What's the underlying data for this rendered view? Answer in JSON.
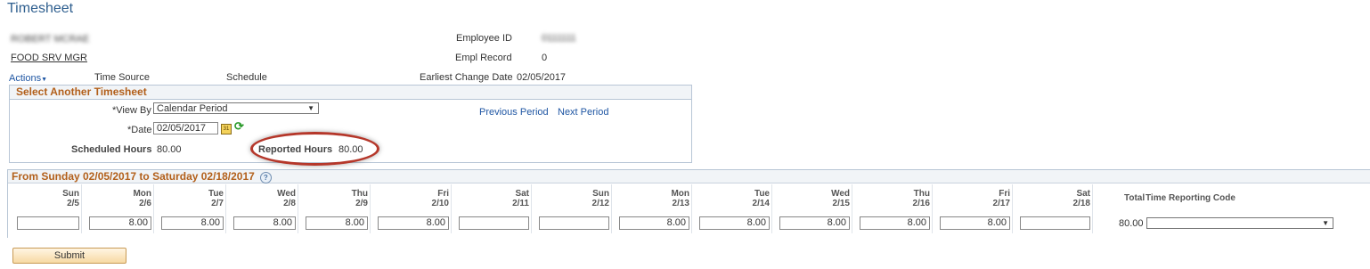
{
  "page": {
    "title": "Timesheet"
  },
  "employee": {
    "name_blurred": "ROBERT MCRAE",
    "job_title": "FOOD SRV MGR",
    "employee_id_label": "Employee ID",
    "employee_id_value": "0111111",
    "empl_record_label": "Empl Record",
    "empl_record_value": "0",
    "earliest_change_label": "Earliest Change Date",
    "earliest_change_value": "02/05/2017",
    "time_source_label": "Time Source",
    "schedule_label": "Schedule",
    "actions_label": "Actions"
  },
  "select_timesheet": {
    "header": "Select Another Timesheet",
    "view_by_label": "*View By",
    "view_by_value": "Calendar Period",
    "date_label": "*Date",
    "date_value": "02/05/2017",
    "previous_period": "Previous Period",
    "next_period": "Next Period",
    "scheduled_hours_label": "Scheduled Hours",
    "scheduled_hours_value": "80.00",
    "reported_hours_label": "Reported Hours",
    "reported_hours_value": "80.00"
  },
  "grid": {
    "header": "From Sunday 02/05/2017 to Saturday 02/18/2017",
    "days": [
      {
        "day": "Sun",
        "date": "2/5",
        "value": ""
      },
      {
        "day": "Mon",
        "date": "2/6",
        "value": "8.00"
      },
      {
        "day": "Tue",
        "date": "2/7",
        "value": "8.00"
      },
      {
        "day": "Wed",
        "date": "2/8",
        "value": "8.00"
      },
      {
        "day": "Thu",
        "date": "2/9",
        "value": "8.00"
      },
      {
        "day": "Fri",
        "date": "2/10",
        "value": "8.00"
      },
      {
        "day": "Sat",
        "date": "2/11",
        "value": ""
      },
      {
        "day": "Sun",
        "date": "2/12",
        "value": ""
      },
      {
        "day": "Mon",
        "date": "2/13",
        "value": "8.00"
      },
      {
        "day": "Tue",
        "date": "2/14",
        "value": "8.00"
      },
      {
        "day": "Wed",
        "date": "2/15",
        "value": "8.00"
      },
      {
        "day": "Thu",
        "date": "2/16",
        "value": "8.00"
      },
      {
        "day": "Fri",
        "date": "2/17",
        "value": "8.00"
      },
      {
        "day": "Sat",
        "date": "2/18",
        "value": ""
      }
    ],
    "total_label": "Total",
    "total_value": "80.00",
    "trc_label": "Time Reporting Code",
    "trc_value": ""
  },
  "buttons": {
    "submit": "Submit"
  },
  "icons": {
    "calendar": "calendar-icon",
    "refresh": "refresh-icon",
    "help": "help-icon",
    "dropdown": "chevron-down-icon"
  },
  "colors": {
    "accent": "#b25f1a",
    "link": "#1f56a3",
    "highlight_oval": "#b5372a"
  }
}
